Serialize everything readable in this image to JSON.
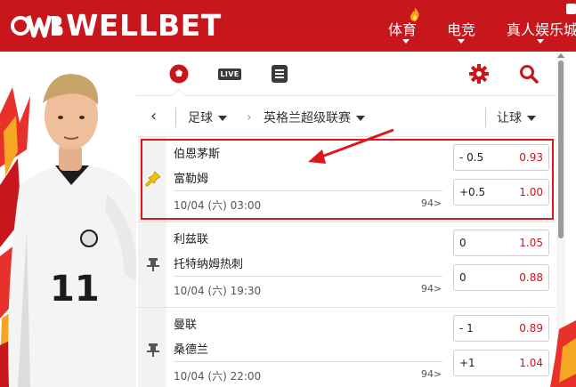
{
  "header": {
    "brand": "WELLBET",
    "nav": [
      {
        "label": "体育"
      },
      {
        "label": "电竞"
      },
      {
        "label": "真人娱乐城"
      }
    ]
  },
  "toolbar": {
    "live_label": "LIVE",
    "icons": [
      "soccer-ball-icon",
      "live-icon",
      "betslip-icon",
      "settings-icon",
      "search-icon"
    ]
  },
  "filters": {
    "sport": "足球",
    "league": "英格兰超级联赛",
    "market": "让球"
  },
  "matches": [
    {
      "home": "伯恩茅斯",
      "away": "富勒姆",
      "time": "10/04 (六) 03:00",
      "more": "94>",
      "pinned": true,
      "odds": [
        {
          "handicap": "- 0.5",
          "value": "0.93"
        },
        {
          "handicap": "+0.5",
          "value": "1.00"
        }
      ]
    },
    {
      "home": "利兹联",
      "away": "托特纳姆热刺",
      "time": "10/04 (六) 19:30",
      "more": "94>",
      "pinned": false,
      "odds": [
        {
          "handicap": "0",
          "value": "1.05"
        },
        {
          "handicap": "0",
          "value": "0.88"
        }
      ]
    },
    {
      "home": "曼联",
      "away": "桑德兰",
      "time": "10/04 (六) 22:00",
      "more": "94>",
      "pinned": false,
      "odds": [
        {
          "handicap": "- 1",
          "value": "0.89"
        },
        {
          "handicap": "+1",
          "value": "1.04"
        }
      ]
    }
  ],
  "colors": {
    "brand_red": "#c8161d",
    "odds_red": "#c8161d",
    "pin_gold": "#f2c200"
  }
}
